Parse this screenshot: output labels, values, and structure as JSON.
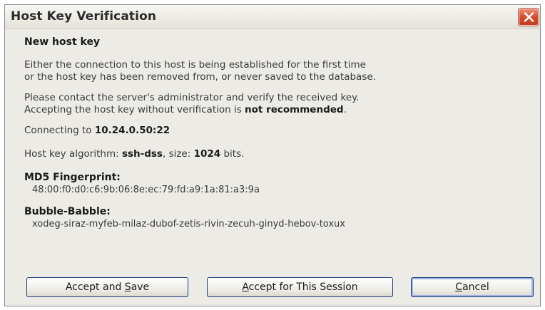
{
  "window": {
    "title": "Host Key Verification",
    "close_icon": "close-icon"
  },
  "message": {
    "heading": "New host key",
    "para1_line1": "Either the connection to this host is being established for the first time",
    "para1_line2": "or the host key has been removed from, or never saved to the database.",
    "para2_line1": "Please contact the server's administrator and verify the received key.",
    "para2_line2_prefix": "Accepting the host key without verification is ",
    "para2_line2_bold": "not recommended",
    "para2_line2_suffix": "."
  },
  "connection": {
    "prefix": "Connecting to ",
    "address": "10.24.0.50:22"
  },
  "algorithm": {
    "prefix": "Host key algorithm: ",
    "name": "ssh-dss",
    "size_prefix": ", size: ",
    "size": "1024",
    "size_suffix": " bits."
  },
  "fingerprint": {
    "label": "MD5 Fingerprint:",
    "value": "48:00:f0:d0:c6:9b:06:8e:ec:79:fd:a9:1a:81:a3:9a"
  },
  "bubble_babble": {
    "label": "Bubble-Babble:",
    "value": "xodeg-siraz-myfeb-milaz-dubof-zetis-rivin-zecuh-ginyd-hebov-toxux"
  },
  "buttons": {
    "accept_save": {
      "before": "Accept and ",
      "mnemonic": "S",
      "after": "ave"
    },
    "accept_session": {
      "before": "",
      "mnemonic": "A",
      "after": "ccept for This Session"
    },
    "cancel": {
      "before": "",
      "mnemonic": "C",
      "after": "ancel"
    }
  },
  "colors": {
    "dialog_bg": "#ecebe6",
    "close_button": "#d4472a",
    "button_border": "#1f3a7a"
  }
}
